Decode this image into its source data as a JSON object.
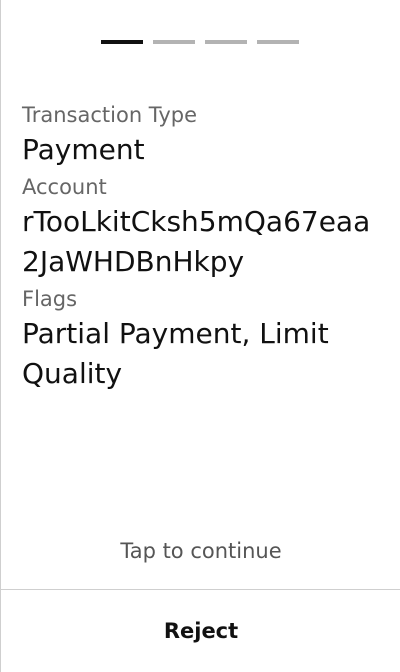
{
  "progress": {
    "steps": 4,
    "current": 1
  },
  "details": {
    "transaction_type_label": "Transaction Type",
    "transaction_type_value": "Payment",
    "account_label": "Account",
    "account_value": "rTooLkitCksh5mQa67eaa2JaWHDBnHkpy",
    "flags_label": "Flags",
    "flags_value": "Partial Payment, Limit Quality"
  },
  "footer": {
    "tap_hint": "Tap to continue",
    "reject_label": "Reject"
  },
  "colors": {
    "text": "#111111",
    "muted": "#666666",
    "progress_active": "#111111",
    "progress_inactive": "#b3b3b3",
    "divider": "#cfcfcf"
  }
}
